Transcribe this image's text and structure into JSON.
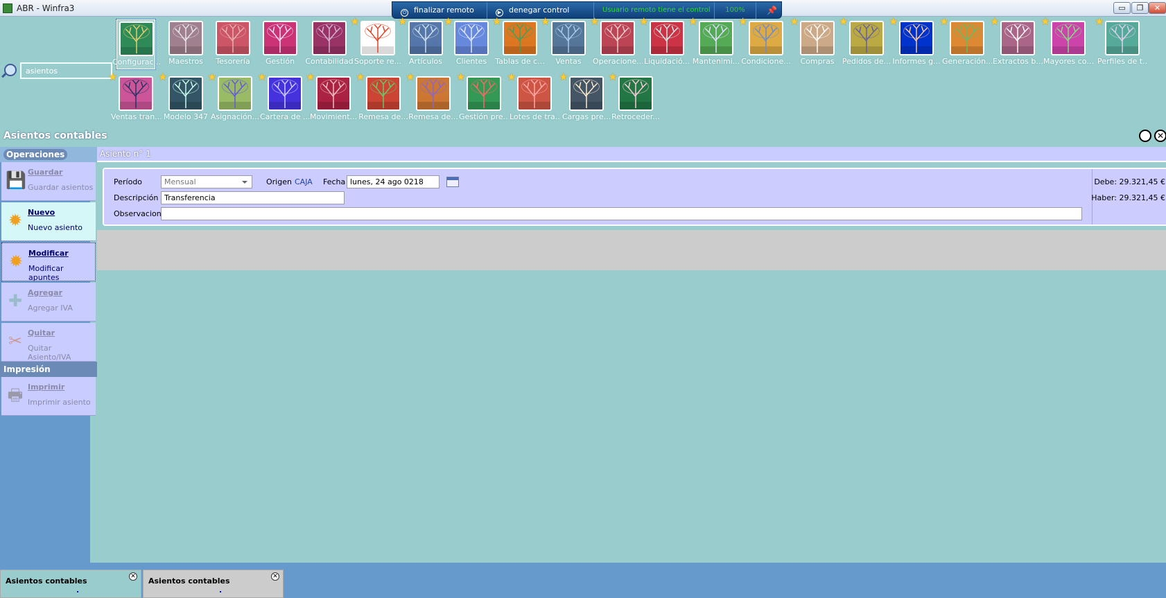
{
  "window": {
    "title": "ABR - Winfra3",
    "min": "▭",
    "max": "❐",
    "close": "✕"
  },
  "remote_bar": {
    "end_label": "finalizar remoto",
    "deny_label": "denegar control",
    "status": "Usuario remoto tiene el control",
    "percent": "100%",
    "pin_icon": "pin-icon"
  },
  "search": {
    "value": "asientos"
  },
  "tiles": [
    {
      "label": "Configurac...",
      "star": false,
      "colors": [
        "#2e8b57",
        "#e0d070"
      ]
    },
    {
      "label": "Maestros",
      "star": false,
      "colors": [
        "#a08090",
        "#e6e6e6"
      ]
    },
    {
      "label": "Tesorería",
      "star": false,
      "colors": [
        "#cc5566",
        "#e6b0b0"
      ]
    },
    {
      "label": "Gestión",
      "star": false,
      "colors": [
        "#cc3377",
        "#f0e0f0"
      ]
    },
    {
      "label": "Contabilidad",
      "star": false,
      "colors": [
        "#993366",
        "#d9b3d9"
      ]
    },
    {
      "label": "Soporte re...",
      "star": true,
      "colors": [
        "#ffffff",
        "#e04020"
      ]
    },
    {
      "label": "Artículos",
      "star": true,
      "colors": [
        "#5577aa",
        "#d0e0f0"
      ]
    },
    {
      "label": "Clientes",
      "star": true,
      "colors": [
        "#6688dd",
        "#e0e8ff"
      ]
    },
    {
      "label": "Tablas de c...",
      "star": true,
      "colors": [
        "#dd7722",
        "#40a060"
      ]
    },
    {
      "label": "Ventas",
      "star": true,
      "colors": [
        "#557799",
        "#aaccee"
      ]
    },
    {
      "label": "Operacione...",
      "star": true,
      "colors": [
        "#bb4455",
        "#f0d0d0"
      ]
    },
    {
      "label": "Liquidació...",
      "star": true,
      "colors": [
        "#cc3344",
        "#d0f0f0"
      ]
    },
    {
      "label": "Mantenimi...",
      "star": true,
      "colors": [
        "#55aa55",
        "#e0e0ff"
      ]
    },
    {
      "label": "Condicione...",
      "star": true,
      "colors": [
        "#ddaa44",
        "#6a8ad0"
      ]
    },
    {
      "label": "Compras",
      "star": true,
      "colors": [
        "#ccaa88",
        "#ffffff"
      ]
    },
    {
      "label": "Pedidos de...",
      "star": true,
      "colors": [
        "#bbaa44",
        "#6060a0"
      ]
    },
    {
      "label": "Informes g...",
      "star": true,
      "colors": [
        "#0033cc",
        "#ffcc99"
      ]
    },
    {
      "label": "Generación...",
      "star": true,
      "colors": [
        "#dd8833",
        "#66bb66"
      ]
    },
    {
      "label": "Extractos b...",
      "star": true,
      "colors": [
        "#aa6688",
        "#ffffff"
      ]
    },
    {
      "label": "Mayores co...",
      "star": true,
      "colors": [
        "#cc44aa",
        "#88dd88"
      ]
    },
    {
      "label": "Perfiles de t...",
      "star": true,
      "colors": [
        "#55aa99",
        "#e0d0f0"
      ]
    },
    {
      "label": "Ventas tran...",
      "star": true,
      "colors": [
        "#cc5599",
        "#223366"
      ]
    },
    {
      "label": "Modelo 347",
      "star": true,
      "colors": [
        "#335566",
        "#ccffee"
      ]
    },
    {
      "label": "Asignación...",
      "star": true,
      "colors": [
        "#99bb66",
        "#6655dd"
      ]
    },
    {
      "label": "Cartera de ...",
      "star": true,
      "colors": [
        "#4433dd",
        "#ccccff"
      ]
    },
    {
      "label": "Movimient...",
      "star": true,
      "colors": [
        "#aa2244",
        "#f0c0c0"
      ]
    },
    {
      "label": "Remesa de...",
      "star": true,
      "colors": [
        "#cc4433",
        "#66cc66"
      ]
    },
    {
      "label": "Remesa de...",
      "star": true,
      "colors": [
        "#cc7733",
        "#8866cc"
      ]
    },
    {
      "label": "Gestión pre...",
      "star": true,
      "colors": [
        "#339955",
        "#ff6666"
      ]
    },
    {
      "label": "Lotes de tra...",
      "star": true,
      "colors": [
        "#cc5544",
        "#ffaaaa"
      ]
    },
    {
      "label": "Cargas pre...",
      "star": true,
      "colors": [
        "#445566",
        "#ffeecc"
      ]
    },
    {
      "label": "Retroceder...",
      "star": true,
      "colors": [
        "#227744",
        "#ffccdd"
      ]
    }
  ],
  "page": {
    "heading": "Asientos contables"
  },
  "sidebar": {
    "operations_title": "Operaciones",
    "print_title": "Impresión",
    "buttons": [
      {
        "title": "Guardar",
        "subtitle": "Guardar asientos",
        "icon": "floppy-icon",
        "glyph": "💾"
      },
      {
        "title": "Nuevo",
        "subtitle": "Nuevo asiento",
        "icon": "sun-icon",
        "glyph": "✹"
      },
      {
        "title": "Modificar",
        "subtitle": "Modificar apuntes",
        "icon": "sun-icon",
        "glyph": "✹"
      },
      {
        "title": "Agregar",
        "subtitle": "Agregar IVA",
        "icon": "plus-icon",
        "glyph": "✚"
      },
      {
        "title": "Quitar",
        "subtitle": "Quitar Asiento/IVA",
        "icon": "scissors-icon",
        "glyph": "✂"
      },
      {
        "title": "Imprimir",
        "subtitle": "Imprimir asiento",
        "icon": "printer-icon",
        "glyph": "🖶"
      }
    ]
  },
  "form": {
    "tab_label": "Asiento n° 1",
    "periodo_label": "Período",
    "periodo_value": "Mensual",
    "origen_label": "Origen",
    "origen_value": "CAJA",
    "fecha_label": "Fecha",
    "fecha_value": "lunes, 24 ago 0218",
    "descripcion_label": "Descripción",
    "descripcion_value": "Transferencia",
    "observaciones_label": "Observaciones",
    "observaciones_value": "",
    "debe": "Debe: 29.321,45 €",
    "haber": "Haber: 29.321,45 €"
  },
  "taskbar": {
    "tabs": [
      {
        "label": "Asientos contables"
      },
      {
        "label": "Asientos contables"
      }
    ]
  }
}
